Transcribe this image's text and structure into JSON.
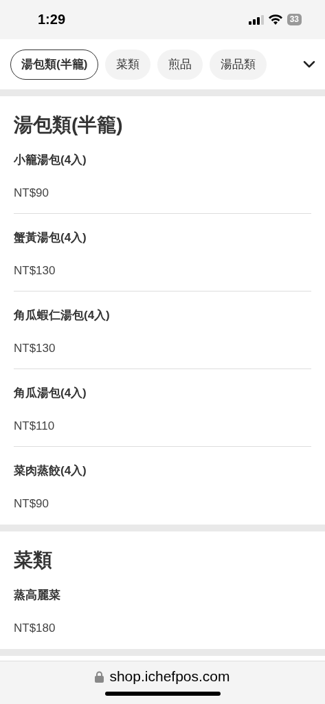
{
  "status_bar": {
    "time": "1:29",
    "battery": "33"
  },
  "category_tabs": [
    {
      "label": "湯包類(半籠)",
      "selected": true
    },
    {
      "label": "菜類",
      "selected": false
    },
    {
      "label": "煎品",
      "selected": false
    },
    {
      "label": "湯品類",
      "selected": false
    }
  ],
  "sections": [
    {
      "title": "湯包類(半籠)",
      "items": [
        {
          "name": "小籠湯包(4入)",
          "price": "NT$90"
        },
        {
          "name": "蟹黃湯包(4入)",
          "price": "NT$130"
        },
        {
          "name": "角瓜蝦仁湯包(4入)",
          "price": "NT$130"
        },
        {
          "name": "角瓜湯包(4入)",
          "price": "NT$110"
        },
        {
          "name": "菜肉蒸餃(4入)",
          "price": "NT$90"
        }
      ]
    },
    {
      "title": "菜類",
      "items": [
        {
          "name": "蒸高麗菜",
          "price": "NT$180"
        }
      ]
    }
  ],
  "url_bar": {
    "url": "shop.ichefpos.com"
  }
}
